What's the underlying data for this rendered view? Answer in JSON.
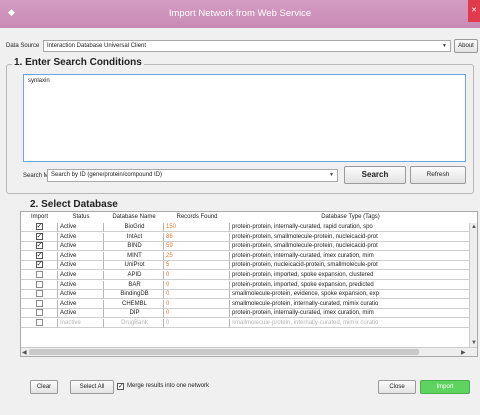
{
  "window": {
    "title": "Import Network from Web Service",
    "close_glyph": "✕"
  },
  "data_source": {
    "label": "Data Source",
    "value": "Interaction Database Universal Client",
    "about_label": "About"
  },
  "section1": {
    "heading": "1. Enter Search Conditions",
    "query_text": "synlaxin",
    "search_mode_label": "Search Mode:",
    "search_mode_value": "Search by ID (gene/protein/compound ID)",
    "search_label": "Search",
    "refresh_label": "Refresh"
  },
  "section2": {
    "heading": "2. Select Database",
    "columns": [
      "Import",
      "Status",
      "Database Name",
      "Records Found",
      "Database Type (Tags)"
    ],
    "rows": [
      {
        "checked": true,
        "status": "Active",
        "name": "BioGrid",
        "records": "150",
        "tags": "protein-protein, internally-curated, rapid curation, spo"
      },
      {
        "checked": true,
        "status": "Active",
        "name": "IntAct",
        "records": "86",
        "tags": "protein-protein, smallmolecule-protein, nucleicacid-prot"
      },
      {
        "checked": true,
        "status": "Active",
        "name": "BIND",
        "records": "59",
        "tags": "protein-protein, smallmolecule-protein, nucleicacid-prot"
      },
      {
        "checked": true,
        "status": "Active",
        "name": "MINT",
        "records": "25",
        "tags": "protein-protein, internally-curated, imex curation, mim"
      },
      {
        "checked": true,
        "status": "Active",
        "name": "UniProt",
        "records": "5",
        "tags": "protein-protein, nucleicacid-protein, smallmolecule-prot"
      },
      {
        "checked": false,
        "status": "Active",
        "name": "APID",
        "records": "0",
        "tags": "protein-protein, imported, spoke expansion, clustered"
      },
      {
        "checked": false,
        "status": "Active",
        "name": "BAR",
        "records": "0",
        "tags": "protein-protein, imported, spoke expansion, predicted"
      },
      {
        "checked": false,
        "status": "Active",
        "name": "BindingDB",
        "records": "0",
        "tags": "smallmolecule-protein, evidence, spoke expansion, exp"
      },
      {
        "checked": false,
        "status": "Active",
        "name": "CHEMBL",
        "records": "0",
        "tags": "smallmolecule-protein, internally-curated, mimix curatio"
      },
      {
        "checked": false,
        "status": "Active",
        "name": "DIP",
        "records": "0",
        "tags": "protein-protein, internally-curated, imex curation, mim"
      },
      {
        "checked": false,
        "status": "Inactive",
        "name": "DrugBank",
        "records": "0",
        "tags": "smallmolecule-protein, internally-curated, mimix curatio"
      }
    ]
  },
  "footer": {
    "clear_label": "Clear",
    "select_all_label": "Select All",
    "merge_label": "Merge results into one network",
    "merge_checked": true,
    "close_label": "Close",
    "import_label": "Import"
  },
  "colors": {
    "titlebar": "#c88ab5",
    "close": "#e03a4d",
    "import_button": "#5fd35f",
    "records_found": "#e07b39"
  }
}
